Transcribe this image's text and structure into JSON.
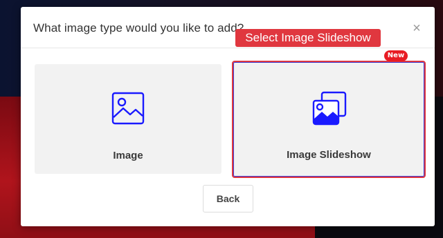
{
  "modal": {
    "title": "What image type would you like to add?",
    "close_symbol": "×",
    "tooltip": "Select Image Slideshow",
    "options": [
      {
        "label": "Image",
        "icon": "image-icon"
      },
      {
        "label": "Image Slideshow",
        "icon": "slideshow-icon",
        "badge": "New",
        "highlighted": true
      }
    ],
    "back_label": "Back"
  },
  "colors": {
    "accent_blue": "#1a1aff",
    "highlight_red": "#e0373f",
    "badge_red": "#e81c24"
  }
}
